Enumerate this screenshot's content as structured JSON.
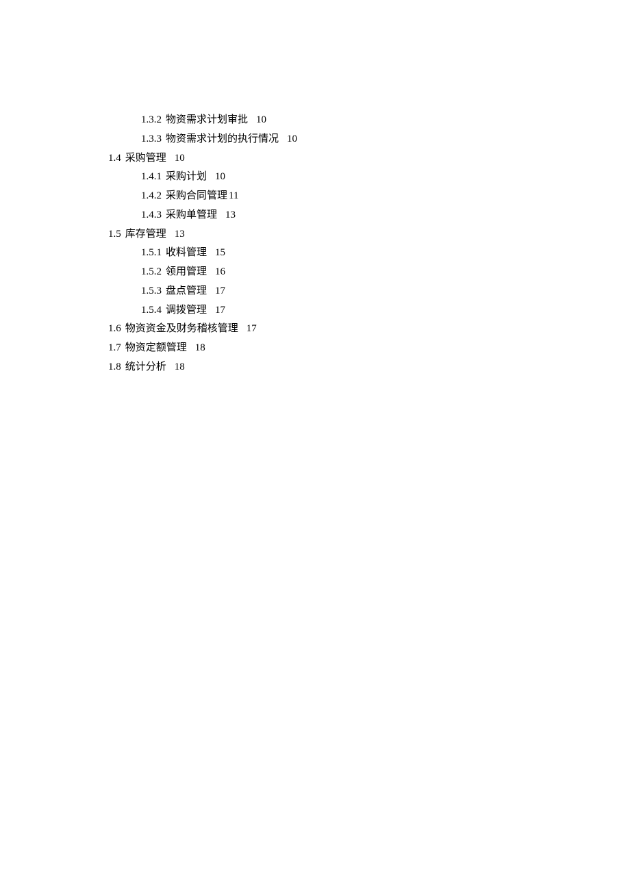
{
  "toc": {
    "entries": [
      {
        "level": 3,
        "num": "1.3.2",
        "title": "物资需求计划审批",
        "page": "10",
        "tight": false
      },
      {
        "level": 3,
        "num": "1.3.3",
        "title": "物资需求计划的执行情况",
        "page": "10",
        "tight": false
      },
      {
        "level": 2,
        "num": "1.4",
        "title": "采购管理",
        "page": "10",
        "tight": false
      },
      {
        "level": 3,
        "num": "1.4.1",
        "title": "采购计划",
        "page": "10",
        "tight": false
      },
      {
        "level": 3,
        "num": "1.4.2",
        "title": "采购合同管理",
        "page": "11",
        "tight": true
      },
      {
        "level": 3,
        "num": "1.4.3",
        "title": "采购单管理",
        "page": "13",
        "tight": false
      },
      {
        "level": 2,
        "num": "1.5",
        "title": "库存管理",
        "page": "13",
        "tight": false
      },
      {
        "level": 3,
        "num": "1.5.1",
        "title": "收料管理",
        "page": "15",
        "tight": false
      },
      {
        "level": 3,
        "num": "1.5.2",
        "title": "领用管理",
        "page": "16",
        "tight": false
      },
      {
        "level": 3,
        "num": "1.5.3",
        "title": "盘点管理",
        "page": "17",
        "tight": false
      },
      {
        "level": 3,
        "num": "1.5.4",
        "title": "调拨管理",
        "page": "17",
        "tight": false
      },
      {
        "level": 2,
        "num": "1.6",
        "title": "物资资金及财务稽核管理",
        "page": "17",
        "tight": false
      },
      {
        "level": 2,
        "num": "1.7",
        "title": "物资定额管理",
        "page": "18",
        "tight": false
      },
      {
        "level": 2,
        "num": "1.8",
        "title": "统计分析",
        "page": "18",
        "tight": false
      }
    ]
  }
}
